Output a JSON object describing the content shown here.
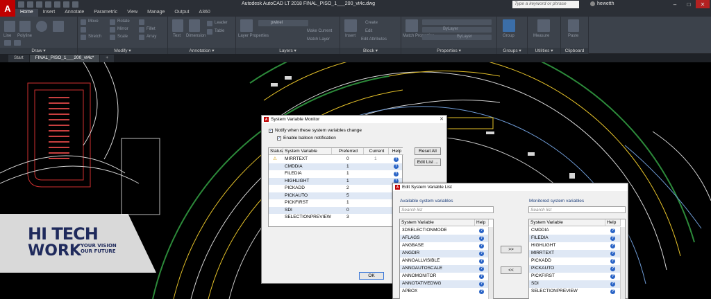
{
  "app": {
    "logo_letter": "A",
    "title": "Autodesk AutoCAD LT 2018    FINAL_PISO_1___200_vt4c.dwg"
  },
  "search": {
    "placeholder": "Type a keyword or phrase"
  },
  "user": {
    "name": "hewetth"
  },
  "window_controls": {
    "minimize": "–",
    "maximize": "□",
    "close": "✕"
  },
  "ribbon_tabs": [
    "Home",
    "Insert",
    "Annotate",
    "Parametric",
    "View",
    "Manage",
    "Output",
    "A360"
  ],
  "ribbon_panels": {
    "draw": "Draw ▾",
    "modify": "Modify ▾",
    "annotation": "Annotation ▾",
    "layers": "Layers ▾",
    "block": "Block ▾",
    "properties": "Properties ▾",
    "groups": "Groups ▾",
    "utilities": "Utilities ▾",
    "clipboard": "Clipboard"
  },
  "ribbon_ghost": {
    "line": "Line",
    "polyline": "Polyline",
    "move": "Move",
    "rotate": "Rotate",
    "mirror": "Mirror",
    "fillet": "Fillet",
    "stretch": "Stretch",
    "scale": "Scale",
    "array": "Array",
    "text": "Text",
    "dimension": "Dimension",
    "leader": "Leader",
    "table": "Table",
    "layer_properties": "Layer Properties",
    "layer_name": "pwinel",
    "make_current": "Make Current",
    "match_layer": "Match Layer",
    "insert": "Insert",
    "create": "Create",
    "edit": "Edit",
    "edit_attributes": "Edit Attributes",
    "match_properties": "Match Properties",
    "bylayer": "ByLayer",
    "group": "Group",
    "measure": "Measure",
    "paste": "Paste"
  },
  "file_tabs": {
    "start": "Start",
    "active": "FINAL_PISO_1___200_vt4c*",
    "add": "+"
  },
  "monitor_dialog": {
    "title": "System Variable Monitor",
    "notify_label": "Notify when these system variables change",
    "balloon_label": "Enable balloon notification",
    "headers": [
      "Status",
      "System Variable",
      "Preferred",
      "Current",
      "Help"
    ],
    "rows": [
      {
        "status": "⚠",
        "name": "MIRRTEXT",
        "preferred": "0",
        "current": "1"
      },
      {
        "status": "",
        "name": "CMDDIA",
        "preferred": "1",
        "current": ""
      },
      {
        "status": "",
        "name": "FILEDIA",
        "preferred": "1",
        "current": ""
      },
      {
        "status": "",
        "name": "HIGHLIGHT",
        "preferred": "1",
        "current": ""
      },
      {
        "status": "",
        "name": "PICKADD",
        "preferred": "2",
        "current": ""
      },
      {
        "status": "",
        "name": "PICKAUTO",
        "preferred": "5",
        "current": ""
      },
      {
        "status": "",
        "name": "PICKFIRST",
        "preferred": "1",
        "current": ""
      },
      {
        "status": "",
        "name": "SDI",
        "preferred": "0",
        "current": ""
      },
      {
        "status": "",
        "name": "SELECTIONPREVIEW",
        "preferred": "3",
        "current": ""
      }
    ],
    "reset_all": "Reset All",
    "edit_list": "Edit List ...",
    "ok": "OK"
  },
  "edit_dialog": {
    "title": "Edit System Variable List",
    "available_label": "Available system variables",
    "monitored_label": "Monitored system variables",
    "search_placeholder": "Search list",
    "col_var": "System Variable",
    "col_help": "Help",
    "available": [
      "3DSELECTIONMODE",
      "AFLAGS",
      "ANGBASE",
      "ANGDIR",
      "ANNOALLVISIBLE",
      "ANNOAUTOSCALE",
      "ANNOMONITOR",
      "ANNOTATIVEDWG",
      "APBOX"
    ],
    "monitored": [
      "CMDDIA",
      "FILEDIA",
      "HIGHLIGHT",
      "MIRRTEXT",
      "PICKADD",
      "PICKAUTO",
      "PICKFIRST",
      "SDI",
      "SELECTIONPREVIEW"
    ],
    "add_btn": ">>",
    "remove_btn": "<<",
    "help_glyph": "?"
  },
  "watermark": {
    "hi": "HI TECH",
    "work": "WORK",
    "tagline_1": "YOUR VISION",
    "tagline_2": "OUR FUTURE"
  }
}
